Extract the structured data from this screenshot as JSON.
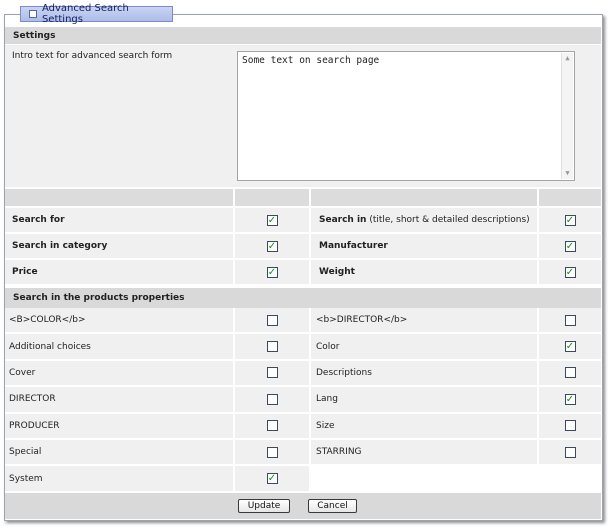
{
  "tab": {
    "label": "Advanced Search Settings"
  },
  "settings": {
    "header": "Settings",
    "intro_label": "Intro text for advanced search form",
    "intro_value": "Some text on search page"
  },
  "options": [
    {
      "left_label": "Search for",
      "left_checked": true,
      "right_label": "Search in",
      "right_note": " (title, short & detailed descriptions)",
      "right_checked": true
    },
    {
      "left_label": "Search in category",
      "left_checked": true,
      "right_label": "Manufacturer",
      "right_note": "",
      "right_checked": true
    },
    {
      "left_label": "Price",
      "left_checked": true,
      "right_label": "Weight",
      "right_note": "",
      "right_checked": true
    }
  ],
  "properties": {
    "header": "Search in the products properties",
    "rows": [
      {
        "left": "<B>COLOR</b>",
        "left_checked": false,
        "right": "<b>DIRECTOR</b>",
        "right_checked": false
      },
      {
        "left": "Additional choices",
        "left_checked": false,
        "right": "Color",
        "right_checked": true
      },
      {
        "left": "Cover",
        "left_checked": false,
        "right": "Descriptions",
        "right_checked": false
      },
      {
        "left": "DIRECTOR",
        "left_checked": false,
        "right": "Lang",
        "right_checked": true
      },
      {
        "left": "PRODUCER",
        "left_checked": false,
        "right": "Size",
        "right_checked": false
      },
      {
        "left": "Special",
        "left_checked": false,
        "right": "STARRING",
        "right_checked": false
      },
      {
        "left": "System",
        "left_checked": true,
        "right": "",
        "right_checked": null
      }
    ]
  },
  "buttons": {
    "update": "Update",
    "cancel": "Cancel"
  },
  "colors": {
    "check": "#168c21",
    "header_bg": "#d9d9d9",
    "row_bg": "#f0f0f0"
  }
}
